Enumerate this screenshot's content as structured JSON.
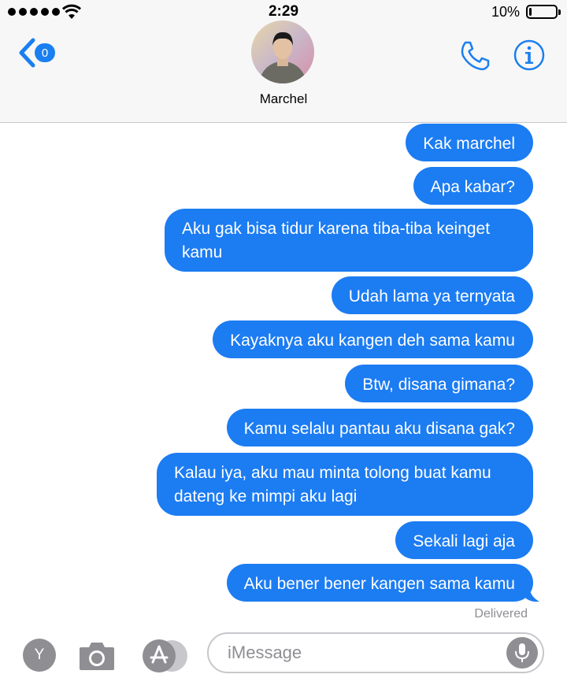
{
  "status_bar": {
    "time": "2:29",
    "battery_text": "10%",
    "battery_level": 0.1,
    "signal_bars": 5
  },
  "header": {
    "back_badge": "0",
    "contact_name": "Marchel",
    "icons": [
      "chevron-left-icon",
      "phone-icon",
      "info-icon"
    ]
  },
  "messages": [
    {
      "text": "Kak marchel"
    },
    {
      "text": "Apa kabar?"
    },
    {
      "text": "Aku gak bisa tidur karena tiba-tiba keinget kamu"
    },
    {
      "text": "Udah lama ya ternyata"
    },
    {
      "text": "Kayaknya aku kangen deh sama kamu"
    },
    {
      "text": "Btw, disana gimana?"
    },
    {
      "text": "Kamu selalu pantau aku disana gak?"
    },
    {
      "text": "Kalau iya, aku mau minta tolong buat kamu dateng ke mimpi aku lagi"
    },
    {
      "text": "Sekali lagi aja"
    },
    {
      "text": "Aku bener bener kangen sama kamu"
    }
  ],
  "delivered_label": "Delivered",
  "input_bar": {
    "app_button_letter": "Y",
    "placeholder": "iMessage"
  },
  "colors": {
    "bubble": "#1c7cf2",
    "accent": "#1a7ff0",
    "muted": "#8e8e93"
  }
}
